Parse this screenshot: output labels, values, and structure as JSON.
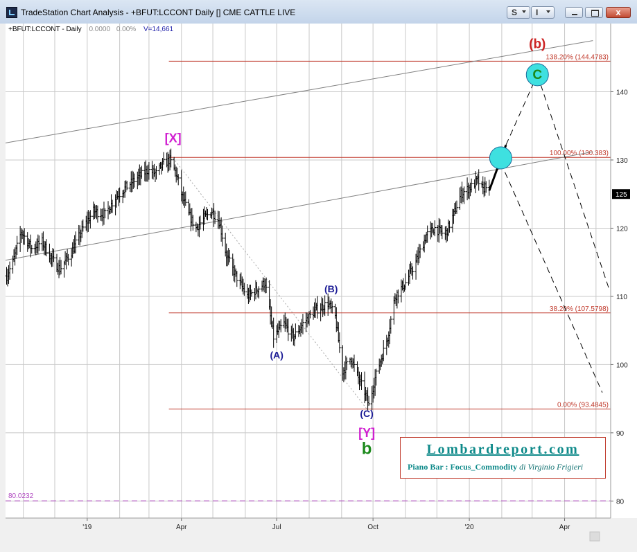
{
  "window": {
    "title": "TradeStation Chart Analysis - +BFUT:LCCONT Daily [] CME CATTLE LIVE",
    "buttons": {
      "s_label": "S",
      "i_label": "I",
      "close_label": "x"
    }
  },
  "header": {
    "symbol": "+BFUT:LCCONT - Daily",
    "change": "0.0000",
    "change_pct": "0.00%",
    "volume": "V=14,661"
  },
  "watermark": {
    "title": "Lombardreport.com",
    "subtitle_bold": "Piano Bar : Focus_Commodity",
    "subtitle_italic": "di Virginio Frigieri"
  },
  "chart_data": {
    "type": "ohlc",
    "symbol": "+BFUT:LCCONT",
    "interval": "Daily",
    "x_ticks": [
      {
        "label": "'19",
        "date": "2019-01-01"
      },
      {
        "label": "Apr",
        "date": "2019-04-01"
      },
      {
        "label": "Jul",
        "date": "2019-07-01"
      },
      {
        "label": "Oct",
        "date": "2019-10-01"
      },
      {
        "label": "'20",
        "date": "2020-01-01"
      },
      {
        "label": "Apr",
        "date": "2020-04-01"
      }
    ],
    "xlim": [
      "2018-10-15",
      "2020-05-15"
    ],
    "y_ticks": [
      80,
      90,
      100,
      110,
      120,
      130,
      140
    ],
    "ylim": [
      77.5,
      150
    ],
    "last_price": "125",
    "grid": true,
    "price_path": [
      [
        "2018-10-16",
        113
      ],
      [
        "2018-10-22",
        115
      ],
      [
        "2018-10-30",
        119.5
      ],
      [
        "2018-11-09",
        117
      ],
      [
        "2018-11-19",
        118
      ],
      [
        "2018-11-28",
        115.5
      ],
      [
        "2018-12-06",
        114
      ],
      [
        "2018-12-17",
        116.5
      ],
      [
        "2018-12-28",
        120
      ],
      [
        "2019-01-07",
        122.5
      ],
      [
        "2019-01-18",
        122
      ],
      [
        "2019-01-28",
        124.5
      ],
      [
        "2019-02-07",
        126
      ],
      [
        "2019-02-19",
        127.5
      ],
      [
        "2019-02-28",
        128.5
      ],
      [
        "2019-03-08",
        128
      ],
      [
        "2019-03-15",
        129.5
      ],
      [
        "2019-03-21",
        130
      ],
      [
        "2019-03-27",
        128
      ],
      [
        "2019-04-02",
        124.5
      ],
      [
        "2019-04-08",
        122
      ],
      [
        "2019-04-15",
        120
      ],
      [
        "2019-04-23",
        121.5
      ],
      [
        "2019-04-30",
        122.5
      ],
      [
        "2019-05-07",
        121
      ],
      [
        "2019-05-14",
        116
      ],
      [
        "2019-05-23",
        113
      ],
      [
        "2019-06-03",
        110
      ],
      [
        "2019-06-12",
        111
      ],
      [
        "2019-06-20",
        112
      ],
      [
        "2019-06-24",
        108
      ],
      [
        "2019-06-28",
        104
      ],
      [
        "2019-07-08",
        106
      ],
      [
        "2019-07-17",
        104
      ],
      [
        "2019-07-26",
        106
      ],
      [
        "2019-08-07",
        108
      ],
      [
        "2019-08-19",
        109
      ],
      [
        "2019-08-26",
        107
      ],
      [
        "2019-09-02",
        99
      ],
      [
        "2019-09-10",
        101
      ],
      [
        "2019-09-17",
        98
      ],
      [
        "2019-09-23",
        96
      ],
      [
        "2019-09-27",
        94
      ],
      [
        "2019-10-03",
        98
      ],
      [
        "2019-10-09",
        101
      ],
      [
        "2019-10-15",
        104
      ],
      [
        "2019-10-22",
        110
      ],
      [
        "2019-11-01",
        112
      ],
      [
        "2019-11-11",
        115
      ],
      [
        "2019-11-21",
        119
      ],
      [
        "2019-11-29",
        120
      ],
      [
        "2019-12-09",
        119
      ],
      [
        "2019-12-17",
        122
      ],
      [
        "2019-12-24",
        125
      ],
      [
        "2020-01-02",
        126
      ],
      [
        "2020-01-09",
        127
      ],
      [
        "2020-01-14",
        125.5
      ],
      [
        "2020-01-17",
        126.5
      ],
      [
        "2020-01-20",
        125.5
      ]
    ],
    "fib_levels": [
      {
        "label": "138.20% (144.4783)",
        "value": 144.4783
      },
      {
        "label": "100.00% (130.383)",
        "value": 130.383
      },
      {
        "label": "38.20% (107.5798)",
        "value": 107.5798
      },
      {
        "label": "0.00% (93.4845)",
        "value": 93.4845
      }
    ],
    "support_line": {
      "label": "80.0232",
      "value": 80.0232
    },
    "wave_labels": [
      {
        "text": "[X]",
        "date": "2019-03-24",
        "y": 132.6,
        "color": "#d020d0"
      },
      {
        "text": "(A)",
        "date": "2019-07-01",
        "y": 100.9,
        "color": "#1c1c96"
      },
      {
        "text": "(B)",
        "date": "2019-08-22",
        "y": 110.6,
        "color": "#1c1c96"
      },
      {
        "text": "(C)",
        "date": "2019-09-25",
        "y": 92.3,
        "color": "#1c1c96"
      },
      {
        "text": "[Y]",
        "date": "2019-09-25",
        "y": 89.4,
        "color": "#d020d0"
      },
      {
        "text": "b",
        "date": "2019-09-25",
        "y": 86.9,
        "color": "#1c8a1c"
      },
      {
        "text": "(b)",
        "date": "2020-03-06",
        "y": 146.4,
        "color": "#cc2222"
      },
      {
        "text": "C",
        "date": "2020-03-06",
        "y": 141.9,
        "color": "#1c8a1c"
      }
    ],
    "channel_lines": [
      {
        "from": [
          "2018-10-15",
          132.5
        ],
        "to": [
          "2020-04-28",
          147.5
        ]
      },
      {
        "from": [
          "2018-10-15",
          115.3
        ],
        "to": [
          "2020-04-28",
          131.2
        ]
      }
    ],
    "dotted_line": {
      "from": [
        "2019-03-24",
        130.3
      ],
      "to": [
        "2019-09-25",
        93.5
      ]
    },
    "projection_lines": [
      {
        "from": [
          "2020-01-20",
          125.5
        ],
        "to": [
          "2020-02-05",
          132.2
        ],
        "style": "solid"
      },
      {
        "from": [
          "2020-02-05",
          132.2
        ],
        "to": [
          "2020-03-06",
          142.5
        ],
        "style": "dashed"
      },
      {
        "from": [
          "2020-03-06",
          142.5
        ],
        "to": [
          "2020-05-13",
          111.3
        ],
        "style": "dashed"
      },
      {
        "from": [
          "2020-01-27",
          131
        ],
        "to": [
          "2020-05-07",
          95.9
        ],
        "style": "dashed"
      }
    ],
    "circles": [
      {
        "date": "2020-01-31",
        "y": 130.3
      },
      {
        "date": "2020-03-06",
        "y": 142.5
      }
    ]
  }
}
